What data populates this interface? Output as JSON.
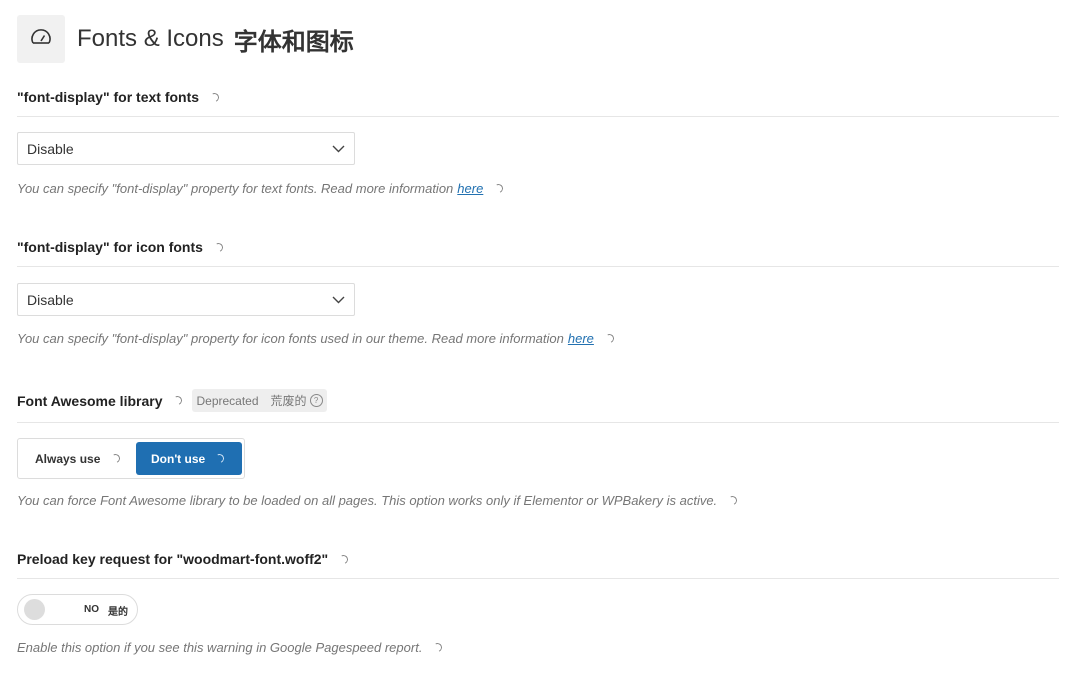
{
  "header": {
    "title": "Fonts & Icons",
    "title_cn": "字体和图标",
    "icon": "speedometer-icon"
  },
  "text_fonts": {
    "title": "\"font-display\" for text fonts",
    "selected": "Disable",
    "desc": "You can specify \"font-display\" property for text fonts. Read more information",
    "link": "here"
  },
  "icon_fonts": {
    "title": "\"font-display\" for icon fonts",
    "selected": "Disable",
    "desc": "You can specify \"font-display\" property for icon fonts used in our theme. Read more information",
    "link": "here"
  },
  "font_awesome": {
    "title": "Font Awesome library",
    "badge": "Deprecated",
    "badge_cn": "荒废的",
    "badge_help": "?",
    "options": [
      "Always use",
      "Don't use"
    ],
    "selected": "Don't use",
    "desc": "You can force Font Awesome library to be loaded on all pages. This option works only if Elementor or WPBakery is active."
  },
  "preload": {
    "title": "Preload key request for \"woodmart-font.woff2\"",
    "toggle_no": "NO",
    "toggle_yes": "是的",
    "state": "off",
    "desc": "Enable this option if you see this warning in Google Pagespeed report."
  },
  "colors": {
    "accent": "#1f6fb2",
    "link": "#2271b1"
  }
}
